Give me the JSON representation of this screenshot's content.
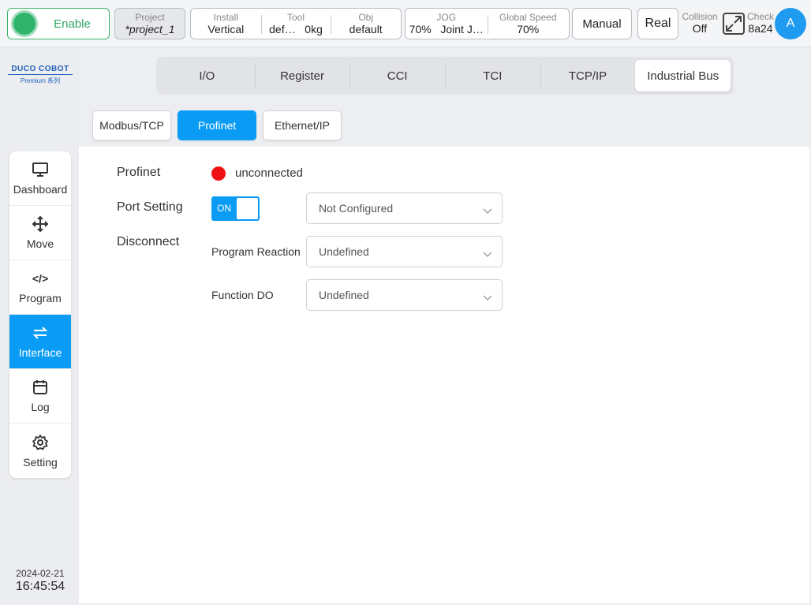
{
  "topbar": {
    "enable_label": "Enable",
    "project": {
      "label": "Project",
      "value": "*project_1"
    },
    "install": {
      "label": "Install",
      "value": "Vertical"
    },
    "tool": {
      "label": "Tool",
      "name": "def…",
      "weight": "0kg"
    },
    "obj": {
      "label": "Obj",
      "value": "default"
    },
    "jog": {
      "label": "JOG",
      "percent": "70%",
      "mode": "Joint J…"
    },
    "global_speed": {
      "label": "Global Speed",
      "value": "70%"
    },
    "manual_label": "Manual",
    "real_label": "Real",
    "collision": {
      "label": "Collision",
      "value": "Off"
    },
    "check": {
      "label": "Check",
      "value": "8a24"
    },
    "avatar_letter": "A"
  },
  "logo": {
    "main": "DUCO COBOT",
    "sub": "Premium 系列"
  },
  "sidebar": {
    "items": [
      {
        "label": "Dashboard",
        "icon": "monitor-icon"
      },
      {
        "label": "Move",
        "icon": "move-arrows-icon"
      },
      {
        "label": "Program",
        "icon": "code-icon",
        "glyph": "</>"
      },
      {
        "label": "Interface",
        "icon": "swap-arrows-icon"
      },
      {
        "label": "Log",
        "icon": "calendar-icon"
      },
      {
        "label": "Setting",
        "icon": "gear-icon"
      }
    ],
    "active_index": 3,
    "date": "2024-02-21",
    "time": "16:45:54"
  },
  "tabs": [
    "I/O",
    "Register",
    "CCI",
    "TCI",
    "TCP/IP",
    "Industrial Bus"
  ],
  "active_tab": "Industrial Bus",
  "subtabs": [
    "Modbus/TCP",
    "Profinet",
    "Ethernet/IP"
  ],
  "active_subtab": "Profinet",
  "profinet": {
    "title": "Profinet",
    "status_text": "unconnected",
    "status_color": "#ee1111",
    "port_setting_label": "Port Setting",
    "toggle_text": "ON",
    "port_select_value": "Not Configured",
    "disconnect_label": "Disconnect",
    "program_reaction_label": "Program Reaction",
    "program_reaction_value": "Undefined",
    "function_do_label": "Function DO",
    "function_do_value": "Undefined"
  },
  "colors": {
    "accent": "#0a9cf5",
    "enable_green": "#2fb36b"
  }
}
